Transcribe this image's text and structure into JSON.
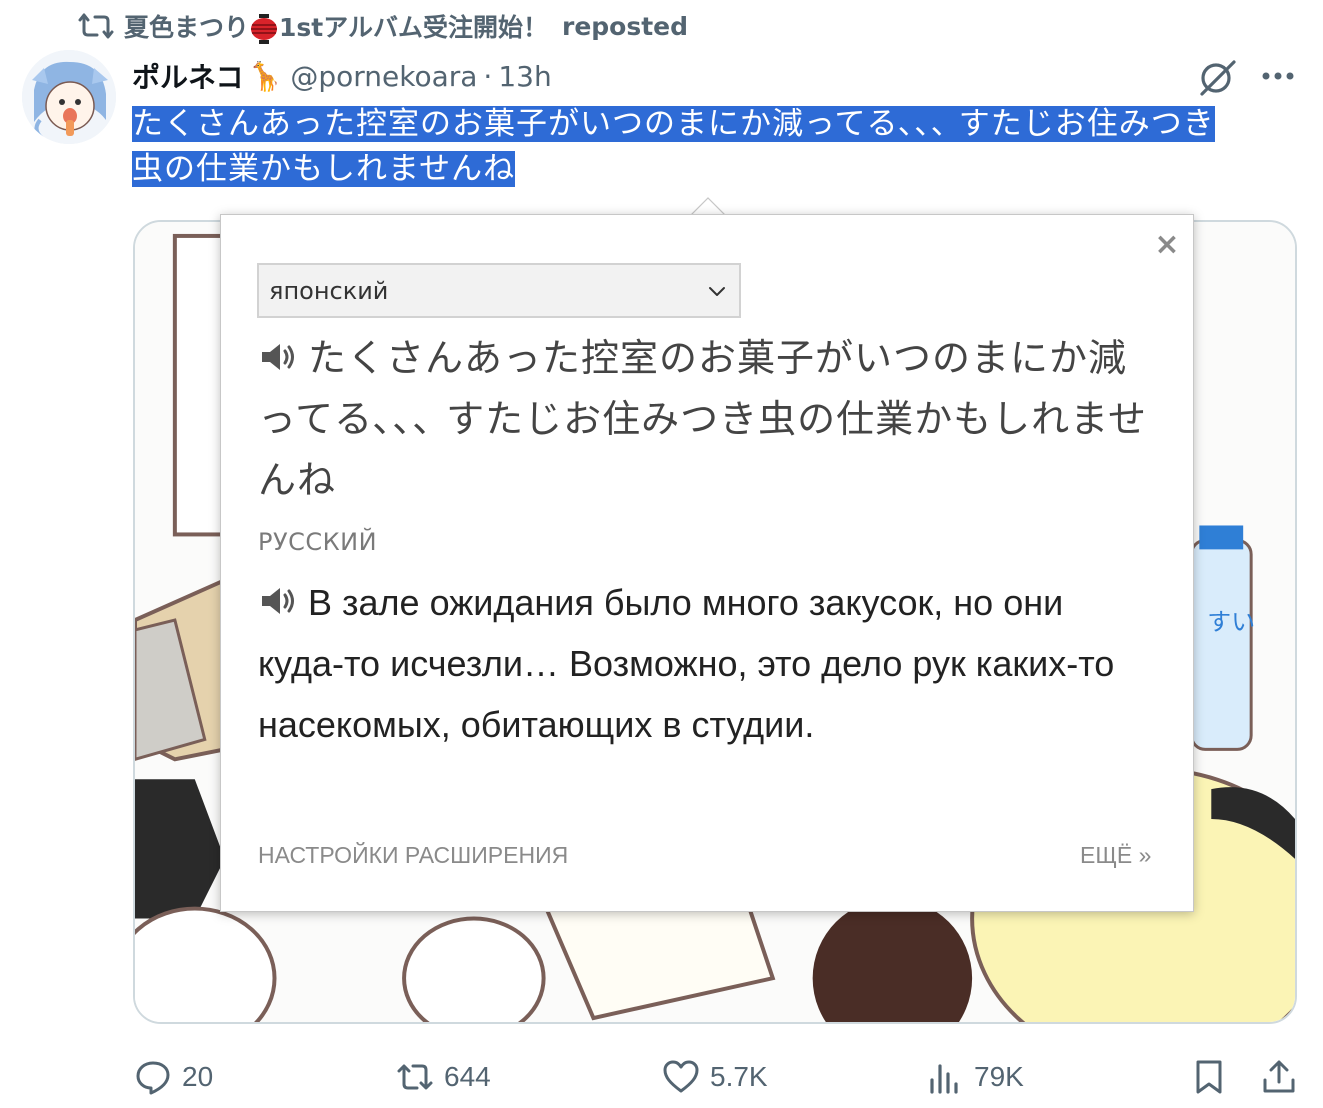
{
  "repost": {
    "icon": "repost-icon",
    "user_prefix": "夏色まつり",
    "lantern_icon": "red-lantern-icon",
    "user_suffix": "1stアルバム受注開始！",
    "label": "reposted"
  },
  "tweet": {
    "display_name": "ポルネコ",
    "name_emoji": "🦒",
    "handle": "@pornekoara",
    "separator": "·",
    "time": "13h",
    "text_line1": "たくさんあった控室のお菓子がいつのまにか減ってる､､､ すたじお住みつき",
    "text_line2": "虫の仕業かもしれませんね",
    "selection_color": "#2e6bd6"
  },
  "translator": {
    "source_language": "японский",
    "source_text": "たくさんあった控室のお菓子がいつのまにか減ってる､､､ すたじお住みつき虫の仕業かもしれませんね",
    "target_label": "РУССКИЙ",
    "target_text": "В зале ожидания было много закусок, но они куда-то исчезли… Возможно, это дело рук каких-то насекомых, обитающих в студии.",
    "close": "×",
    "settings": "НАСТРОЙКИ РАСШИРЕНИЯ",
    "more": "ЕЩЁ »"
  },
  "actions": {
    "replies": "20",
    "reposts": "644",
    "likes": "5.7K",
    "views": "79K"
  },
  "colors": {
    "muted": "#536471",
    "border": "#cfd9de",
    "text": "#0f1419"
  }
}
